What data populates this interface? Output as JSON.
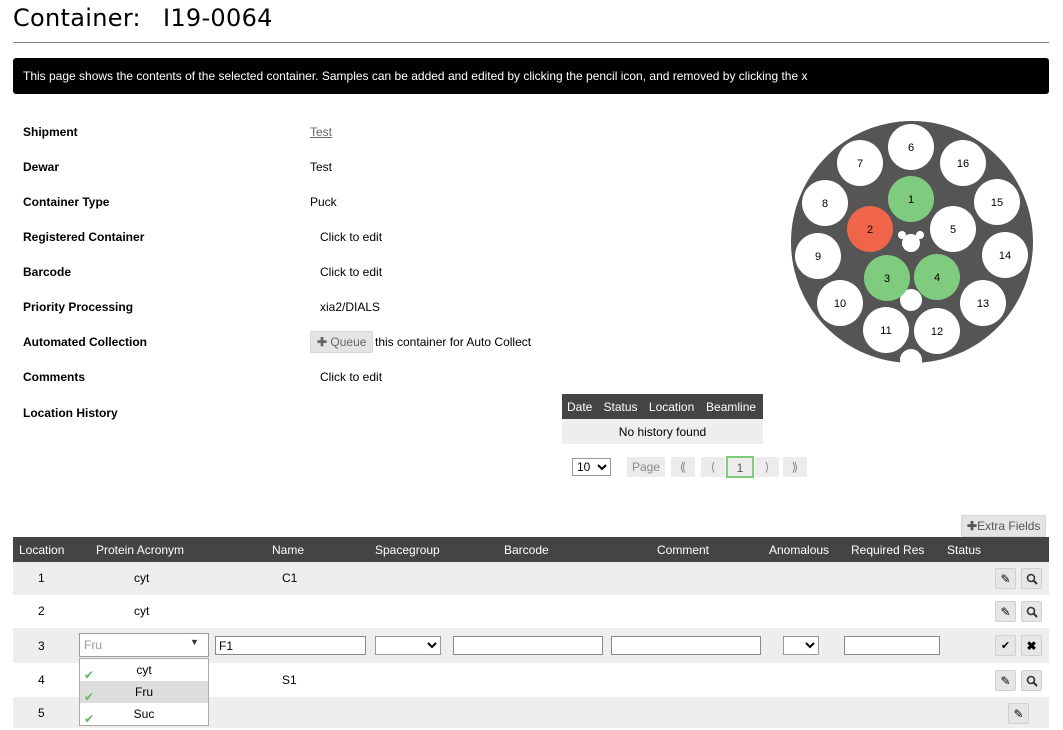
{
  "title": {
    "label": "Container:",
    "code": "I19-0064"
  },
  "notice": "This page shows the contents of the selected container. Samples can be added and edited by clicking the pencil icon, and removed by clicking the x",
  "details": {
    "shipment": {
      "label": "Shipment",
      "value": "Test"
    },
    "dewar": {
      "label": "Dewar",
      "value": "Test"
    },
    "container_type": {
      "label": "Container Type",
      "value": "Puck"
    },
    "registered": {
      "label": "Registered Container",
      "value": "Click to edit"
    },
    "barcode": {
      "label": "Barcode",
      "value": "Click to edit"
    },
    "priority": {
      "label": "Priority Processing",
      "value": "xia2/DIALS"
    },
    "auto": {
      "label": "Automated Collection",
      "button": "Queue",
      "suffix": "this container for Auto Collect"
    },
    "comments": {
      "label": "Comments",
      "value": "Click to edit"
    },
    "location_history": {
      "label": "Location History"
    }
  },
  "history": {
    "headers": [
      "Date",
      "Status",
      "Location",
      "Beamline"
    ],
    "empty": "No history found",
    "page_size": "10",
    "page_label": "Page",
    "current_page": "1",
    "first": "⟪",
    "prev": "⟨",
    "next": "⟩",
    "last": "⟫"
  },
  "puck": {
    "positions": [
      "1",
      "2",
      "3",
      "4",
      "5",
      "6",
      "7",
      "8",
      "9",
      "10",
      "11",
      "12",
      "13",
      "14",
      "15",
      "16"
    ],
    "colors": {
      "filled": "#7fcc7f",
      "error": "#f0654a",
      "empty": "#ffffff",
      "body": "#555555"
    }
  },
  "extra_fields": "Extra Fields",
  "samples": {
    "headers": [
      "Location",
      "Protein Acronym",
      "Name",
      "Spacegroup",
      "Barcode",
      "Comment",
      "Anomalous",
      "Required Res",
      "Status"
    ],
    "rows": [
      {
        "location": "1",
        "protein": "cyt",
        "name": "C1"
      },
      {
        "location": "2",
        "protein": "cyt",
        "name": ""
      },
      {
        "location": "3",
        "protein": "Fru",
        "name": "F1",
        "editing": true
      },
      {
        "location": "4",
        "protein": "",
        "name": "S1"
      },
      {
        "location": "5",
        "protein": "",
        "name": ""
      }
    ],
    "edit_row": {
      "protein_placeholder": "Fru",
      "name_value": "F1"
    },
    "protein_options": [
      "cyt",
      "Fru",
      "Suc"
    ],
    "selected_option": "Fru"
  }
}
